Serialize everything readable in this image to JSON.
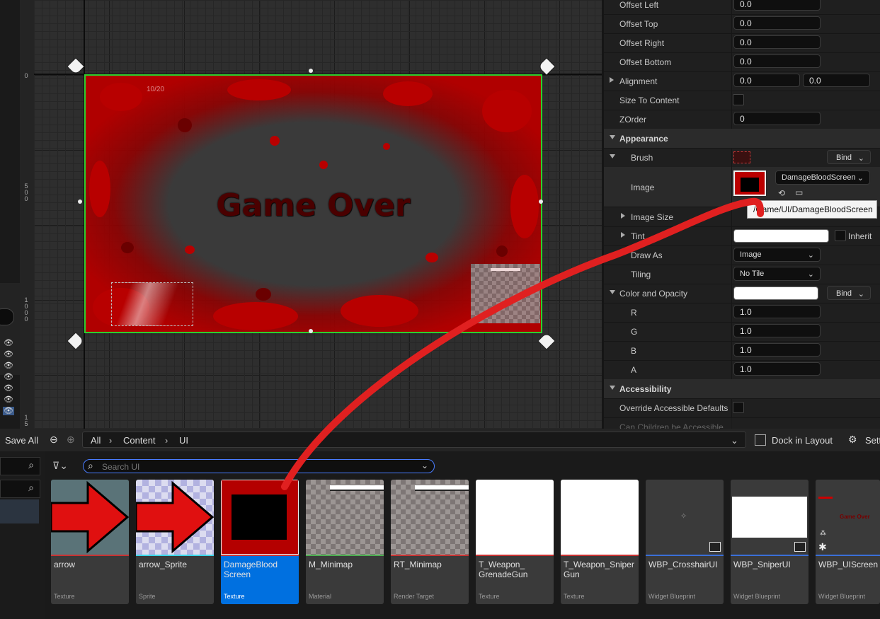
{
  "canvas": {
    "game_over_text": "Game Over",
    "small_label": "10/20",
    "ruler_ticks": [
      "0",
      "5\n0\n0",
      "1\n0\n0\n0",
      "1\n5"
    ]
  },
  "details": {
    "rows": {
      "offset_left": {
        "label": "Offset Left",
        "value": "0.0"
      },
      "offset_top": {
        "label": "Offset Top",
        "value": "0.0"
      },
      "offset_right": {
        "label": "Offset Right",
        "value": "0.0"
      },
      "offset_bottom": {
        "label": "Offset Bottom",
        "value": "0.0"
      },
      "alignment": {
        "label": "Alignment",
        "value_x": "0.0",
        "value_y": "0.0"
      },
      "size_to_content": {
        "label": "Size To Content"
      },
      "zorder": {
        "label": "ZOrder",
        "value": "0"
      },
      "appearance": {
        "label": "Appearance"
      },
      "brush": {
        "label": "Brush",
        "bind": "Bind"
      },
      "image": {
        "label": "Image",
        "asset": "DamageBloodScreen"
      },
      "image_size": {
        "label": "Image Size"
      },
      "tint": {
        "label": "Tint",
        "inherit": "Inherit"
      },
      "draw_as": {
        "label": "Draw As",
        "value": "Image"
      },
      "tiling": {
        "label": "Tiling",
        "value": "No Tile"
      },
      "color_opacity": {
        "label": "Color and Opacity",
        "bind": "Bind"
      },
      "r": {
        "label": "R",
        "value": "1.0"
      },
      "g": {
        "label": "G",
        "value": "1.0"
      },
      "b": {
        "label": "B",
        "value": "1.0"
      },
      "a": {
        "label": "A",
        "value": "1.0"
      },
      "accessibility": {
        "label": "Accessibility"
      },
      "override_accessible": {
        "label": "Override Accessible Defaults"
      },
      "can_children": {
        "label": "Can Children be Accessible"
      }
    },
    "tooltip": "/Game/UI/DamageBloodScreen"
  },
  "toolbar": {
    "save_all": "Save All",
    "breadcrumbs": [
      "All",
      "Content",
      "UI"
    ],
    "dock_in_layout": "Dock in Layout",
    "settings": "Sett"
  },
  "content_browser": {
    "search_placeholder": "Search UI",
    "assets": [
      {
        "name": "arrow",
        "type": "Texture",
        "bar_color": "#c83232"
      },
      {
        "name": "arrow_Sprite",
        "type": "Sprite",
        "bar_color": "#3ad6e8"
      },
      {
        "name": "DamageBlood Screen",
        "type": "Texture",
        "bar_color": "#c83232"
      },
      {
        "name": "M_Minimap",
        "type": "Material",
        "bar_color": "#4caf50"
      },
      {
        "name": "RT_Minimap",
        "type": "Render Target",
        "bar_color": "#c83232"
      },
      {
        "name": "T_Weapon_ GrenadeGun",
        "type": "Texture",
        "bar_color": "#c83232"
      },
      {
        "name": "T_Weapon_Sniper Gun",
        "type": "Texture",
        "bar_color": "#c83232"
      },
      {
        "name": "WBP_CrosshairUI",
        "type": "Widget Blueprint",
        "bar_color": "#3a6fd8"
      },
      {
        "name": "WBP_SniperUI",
        "type": "Widget Blueprint",
        "bar_color": "#3a6fd8"
      },
      {
        "name": "WBP_UIScreen",
        "type": "Widget Blueprint",
        "bar_color": "#3a6fd8"
      }
    ],
    "uiscreen_thumb_text": "Game Over"
  },
  "colors": {
    "selection": "#0070e0",
    "widget_outline": "#2ecf2e",
    "drag_arrow": "#e02020"
  }
}
